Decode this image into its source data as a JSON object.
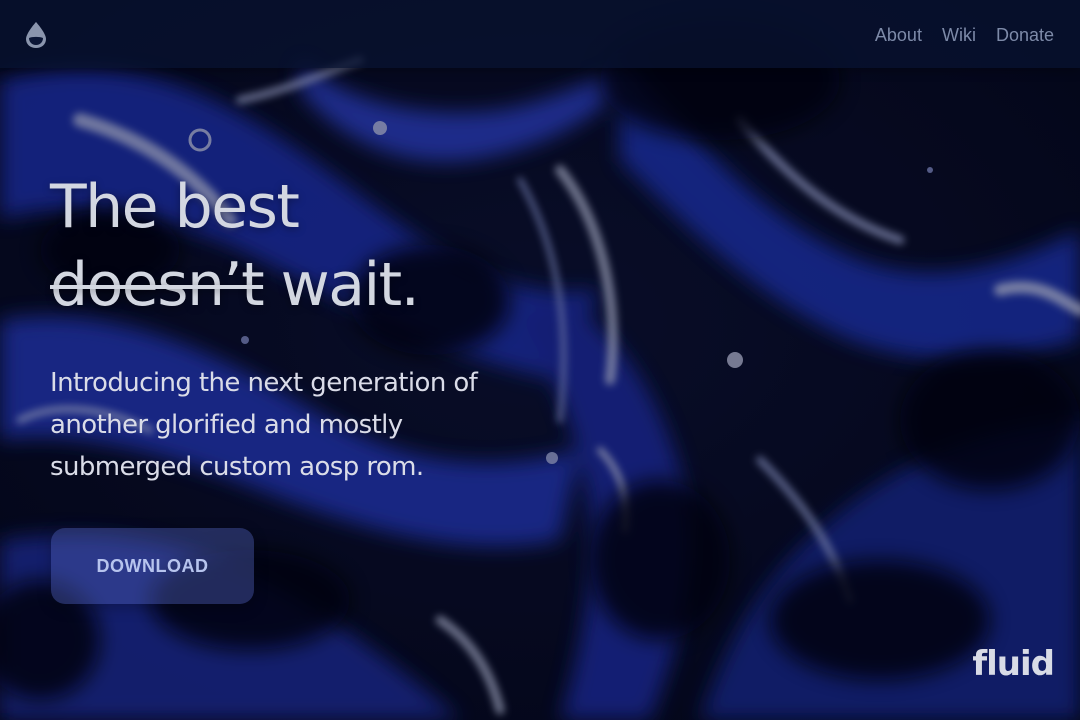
{
  "nav": {
    "links": [
      {
        "label": "About"
      },
      {
        "label": "Wiki"
      },
      {
        "label": "Donate"
      }
    ],
    "logo_icon": "drop-icon"
  },
  "hero": {
    "headline_line1": "The best",
    "headline_struck": "doesn’t",
    "headline_rest": " wait.",
    "tagline": "Introducing the next generation of another glorified and mostly submerged custom aosp rom.",
    "download_label": "DOWNLOAD",
    "wordmark": "fluid"
  },
  "colors": {
    "accent": "#4e60b4",
    "text": "#d3d7e1",
    "nav_text": "#7d8aa8",
    "background": "#060a1a"
  }
}
